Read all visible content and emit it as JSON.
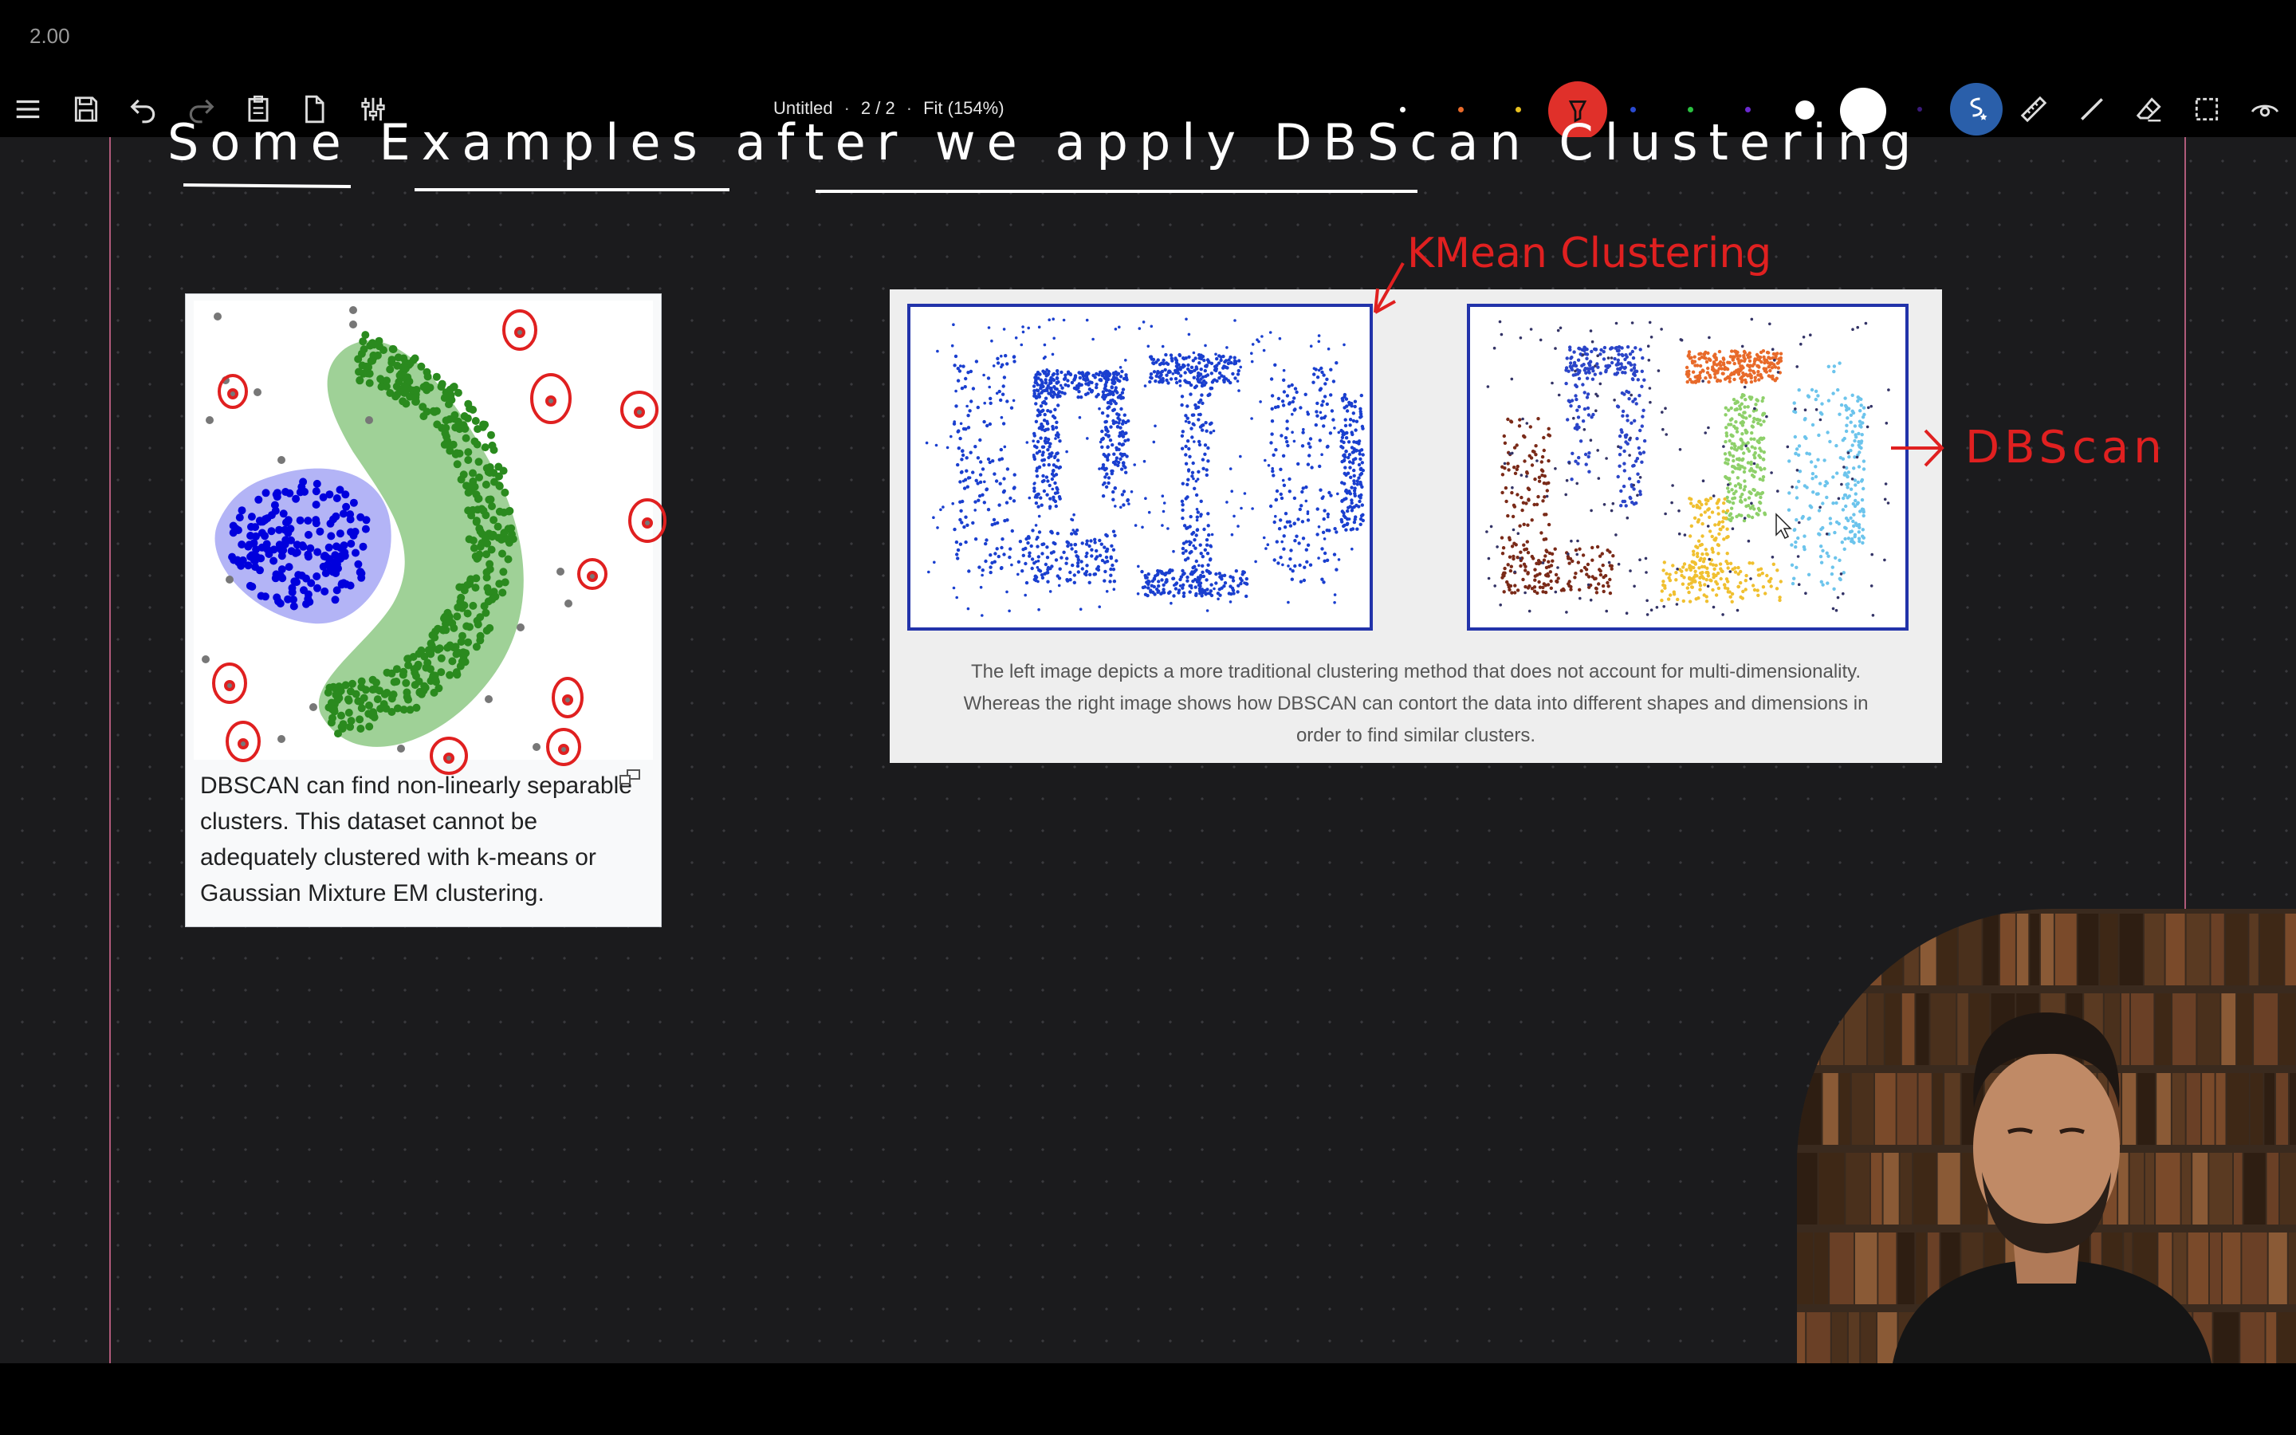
{
  "zoom_readout": "2.00",
  "toolbar": {
    "doc_title": "Untitled",
    "page_indicator": "2 / 2",
    "fit_label": "Fit (154%)",
    "icons": [
      "menu-icon",
      "save-icon",
      "undo-icon",
      "redo-icon",
      "paste-icon",
      "new-page-icon",
      "settings-sliders-icon",
      "highlighter-icon",
      "shape-pen-icon",
      "ruler-icon",
      "line-icon",
      "eraser-icon",
      "selection-icon",
      "view-icon"
    ],
    "colors": {
      "active_tool": "#e0302a",
      "secondary_tool": "#2a6cb5",
      "ink": "#e02020"
    }
  },
  "slide": {
    "heading": "Some Examples after we apply DBScan Clustering",
    "annotation_kmeans": "KMean Clustering",
    "annotation_dbscan": "DBScan"
  },
  "left_figure": {
    "caption": "DBSCAN can find non-linearly separable clusters. This dataset cannot be adequately clustered with k-means or Gaussian Mixture EM clustering.",
    "colors": {
      "cluster_blue": "#0000dd",
      "cluster_green": "#2a8a1e",
      "noise": "#777777"
    }
  },
  "right_figure": {
    "caption_line1": "The left image depicts a more traditional clustering method that does not account for multi-dimensionality.",
    "caption_line2": "Whereas the right image shows how DBSCAN can contort the data into different shapes and dimensions in",
    "caption_line3": "order to find similar clusters.",
    "colors": {
      "kmeans_points": "#1a3fcf",
      "dbscan_brown": "#7a2a18",
      "dbscan_blue": "#2b45c8",
      "dbscan_orange": "#e86a2a",
      "dbscan_green": "#8ed06a",
      "dbscan_yellow": "#f0c030",
      "dbscan_cyan": "#6cc4ec"
    }
  }
}
